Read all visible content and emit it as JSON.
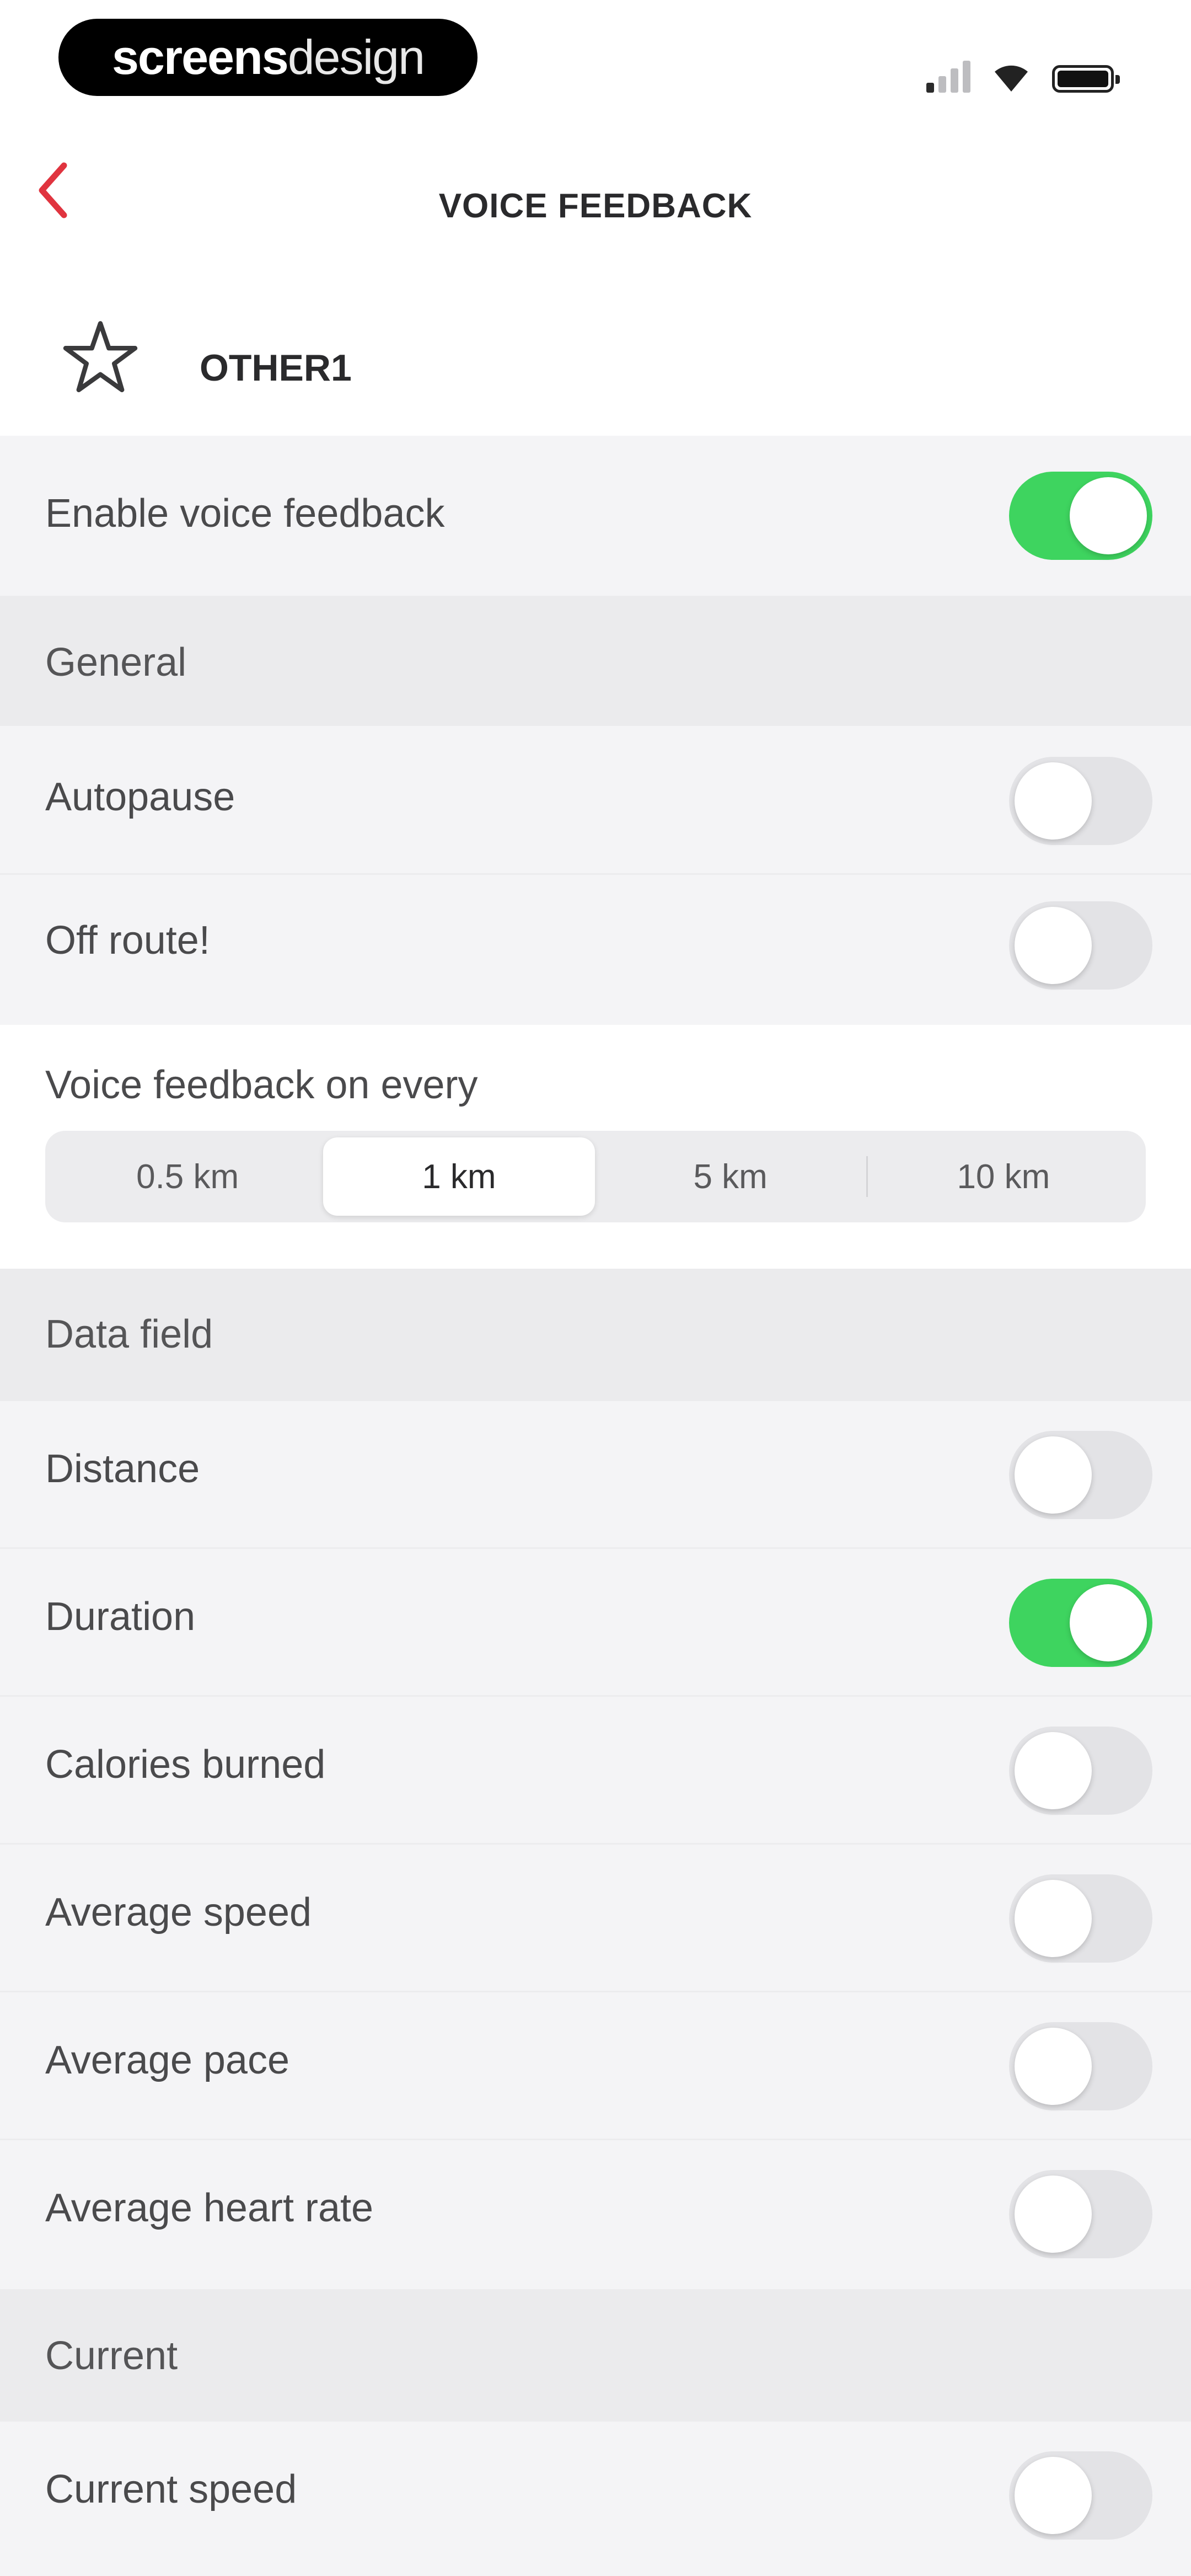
{
  "status_bar": {
    "brand_bold": "screens",
    "brand_light": "design",
    "signal_icon": "cellular-signal-icon",
    "wifi_icon": "wifi-icon",
    "battery_icon": "battery-icon"
  },
  "nav": {
    "back_icon": "chevron-left-icon",
    "title": "VOICE FEEDBACK"
  },
  "profile": {
    "icon": "star-icon",
    "name": "OTHER1"
  },
  "enable": {
    "label": "Enable voice feedback",
    "on": true
  },
  "general": {
    "header": "General",
    "items": [
      {
        "label": "Autopause",
        "on": false
      },
      {
        "label": "Off route!",
        "on": false
      }
    ]
  },
  "frequency": {
    "label": "Voice feedback on every",
    "options": [
      "0.5 km",
      "1 km",
      "5 km",
      "10 km"
    ],
    "selected": "1 km"
  },
  "data_field": {
    "header": "Data field",
    "items": [
      {
        "label": "Distance",
        "on": false
      },
      {
        "label": "Duration",
        "on": true
      },
      {
        "label": "Calories burned",
        "on": false
      },
      {
        "label": "Average speed",
        "on": false
      },
      {
        "label": "Average pace",
        "on": false
      },
      {
        "label": "Average heart rate",
        "on": false
      }
    ]
  },
  "current": {
    "header": "Current",
    "items": [
      {
        "label": "Current speed",
        "on": false
      }
    ]
  },
  "colors": {
    "accent_red": "#e0343f",
    "toggle_on": "#3ed45f",
    "toggle_off": "#e3e3e6"
  }
}
